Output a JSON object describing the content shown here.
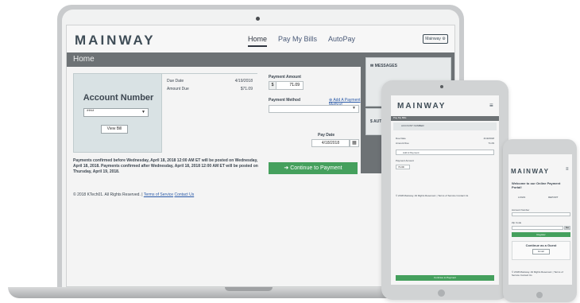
{
  "laptop": {
    "logo": "MAINWAY",
    "nav": [
      "Home",
      "Pay My Bills",
      "AutoPay"
    ],
    "user_button": "Mainway",
    "page_title": "Home",
    "account": {
      "title": "Account Number",
      "select_value": "****",
      "view_bill": "View Bill"
    },
    "due": {
      "due_date_label": "Due Date",
      "due_date_value": "4/19/2018",
      "amount_due_label": "Amount Due",
      "amount_due_value": "$71.09"
    },
    "payment": {
      "amount_label": "Payment Amount",
      "currency": "$",
      "amount_value": "71.09",
      "method_label": "Payment Method",
      "add_method": "Add A Payment Method",
      "date_label": "Pay Date",
      "date_value": "4/18/2018"
    },
    "notice": "Payments confirmed before Wednesday, April 18, 2018 12:00 AM ET will be posted on Wednesday, April 18, 2018. Payments confirmed after Wednesday, April 18, 2018 12:00 AM ET will be posted on Thursday, April 19, 2018.",
    "continue_button": "Continue to Payment",
    "footer": {
      "copyright": "© 2018 KTech01. All Rights Reserved. |",
      "terms": "Terms of Service",
      "contact": "Contact Us"
    },
    "side": {
      "messages": "MESSAGES",
      "autopay": "AUTOPAY"
    }
  },
  "tablet": {
    "logo": "MAINWAY",
    "bar_title": "Pay My Bills",
    "account_label": "ACCOUNT NUMBER",
    "due_date_label": "Due Date",
    "due_date_value": "4/19/2018",
    "amount_due_label": "Amount Due",
    "amount_due_value": "71.09",
    "add_payment": "Add A Payment",
    "payment_amount_label": "Payment Amount",
    "amount_value": "71.09",
    "footer": "© 2018 Mainway. All Rights Reserved. | Terms of Service Contact Us",
    "continue": "Continue to Payment"
  },
  "phone": {
    "logo": "MAINWAY",
    "welcome": "Welcome to our Online Payment Portal!",
    "tab_left": "LOGIN",
    "tab_right": "REPORT",
    "account_label": "Account Number",
    "zip_label": "Zip Code",
    "go": "Go",
    "register": "Register",
    "guest_title": "Continue as a Guest",
    "email_button": "Email",
    "footer": "© 2018 Mainway. All Rights Reserved. | Terms of Service Contact Us"
  }
}
